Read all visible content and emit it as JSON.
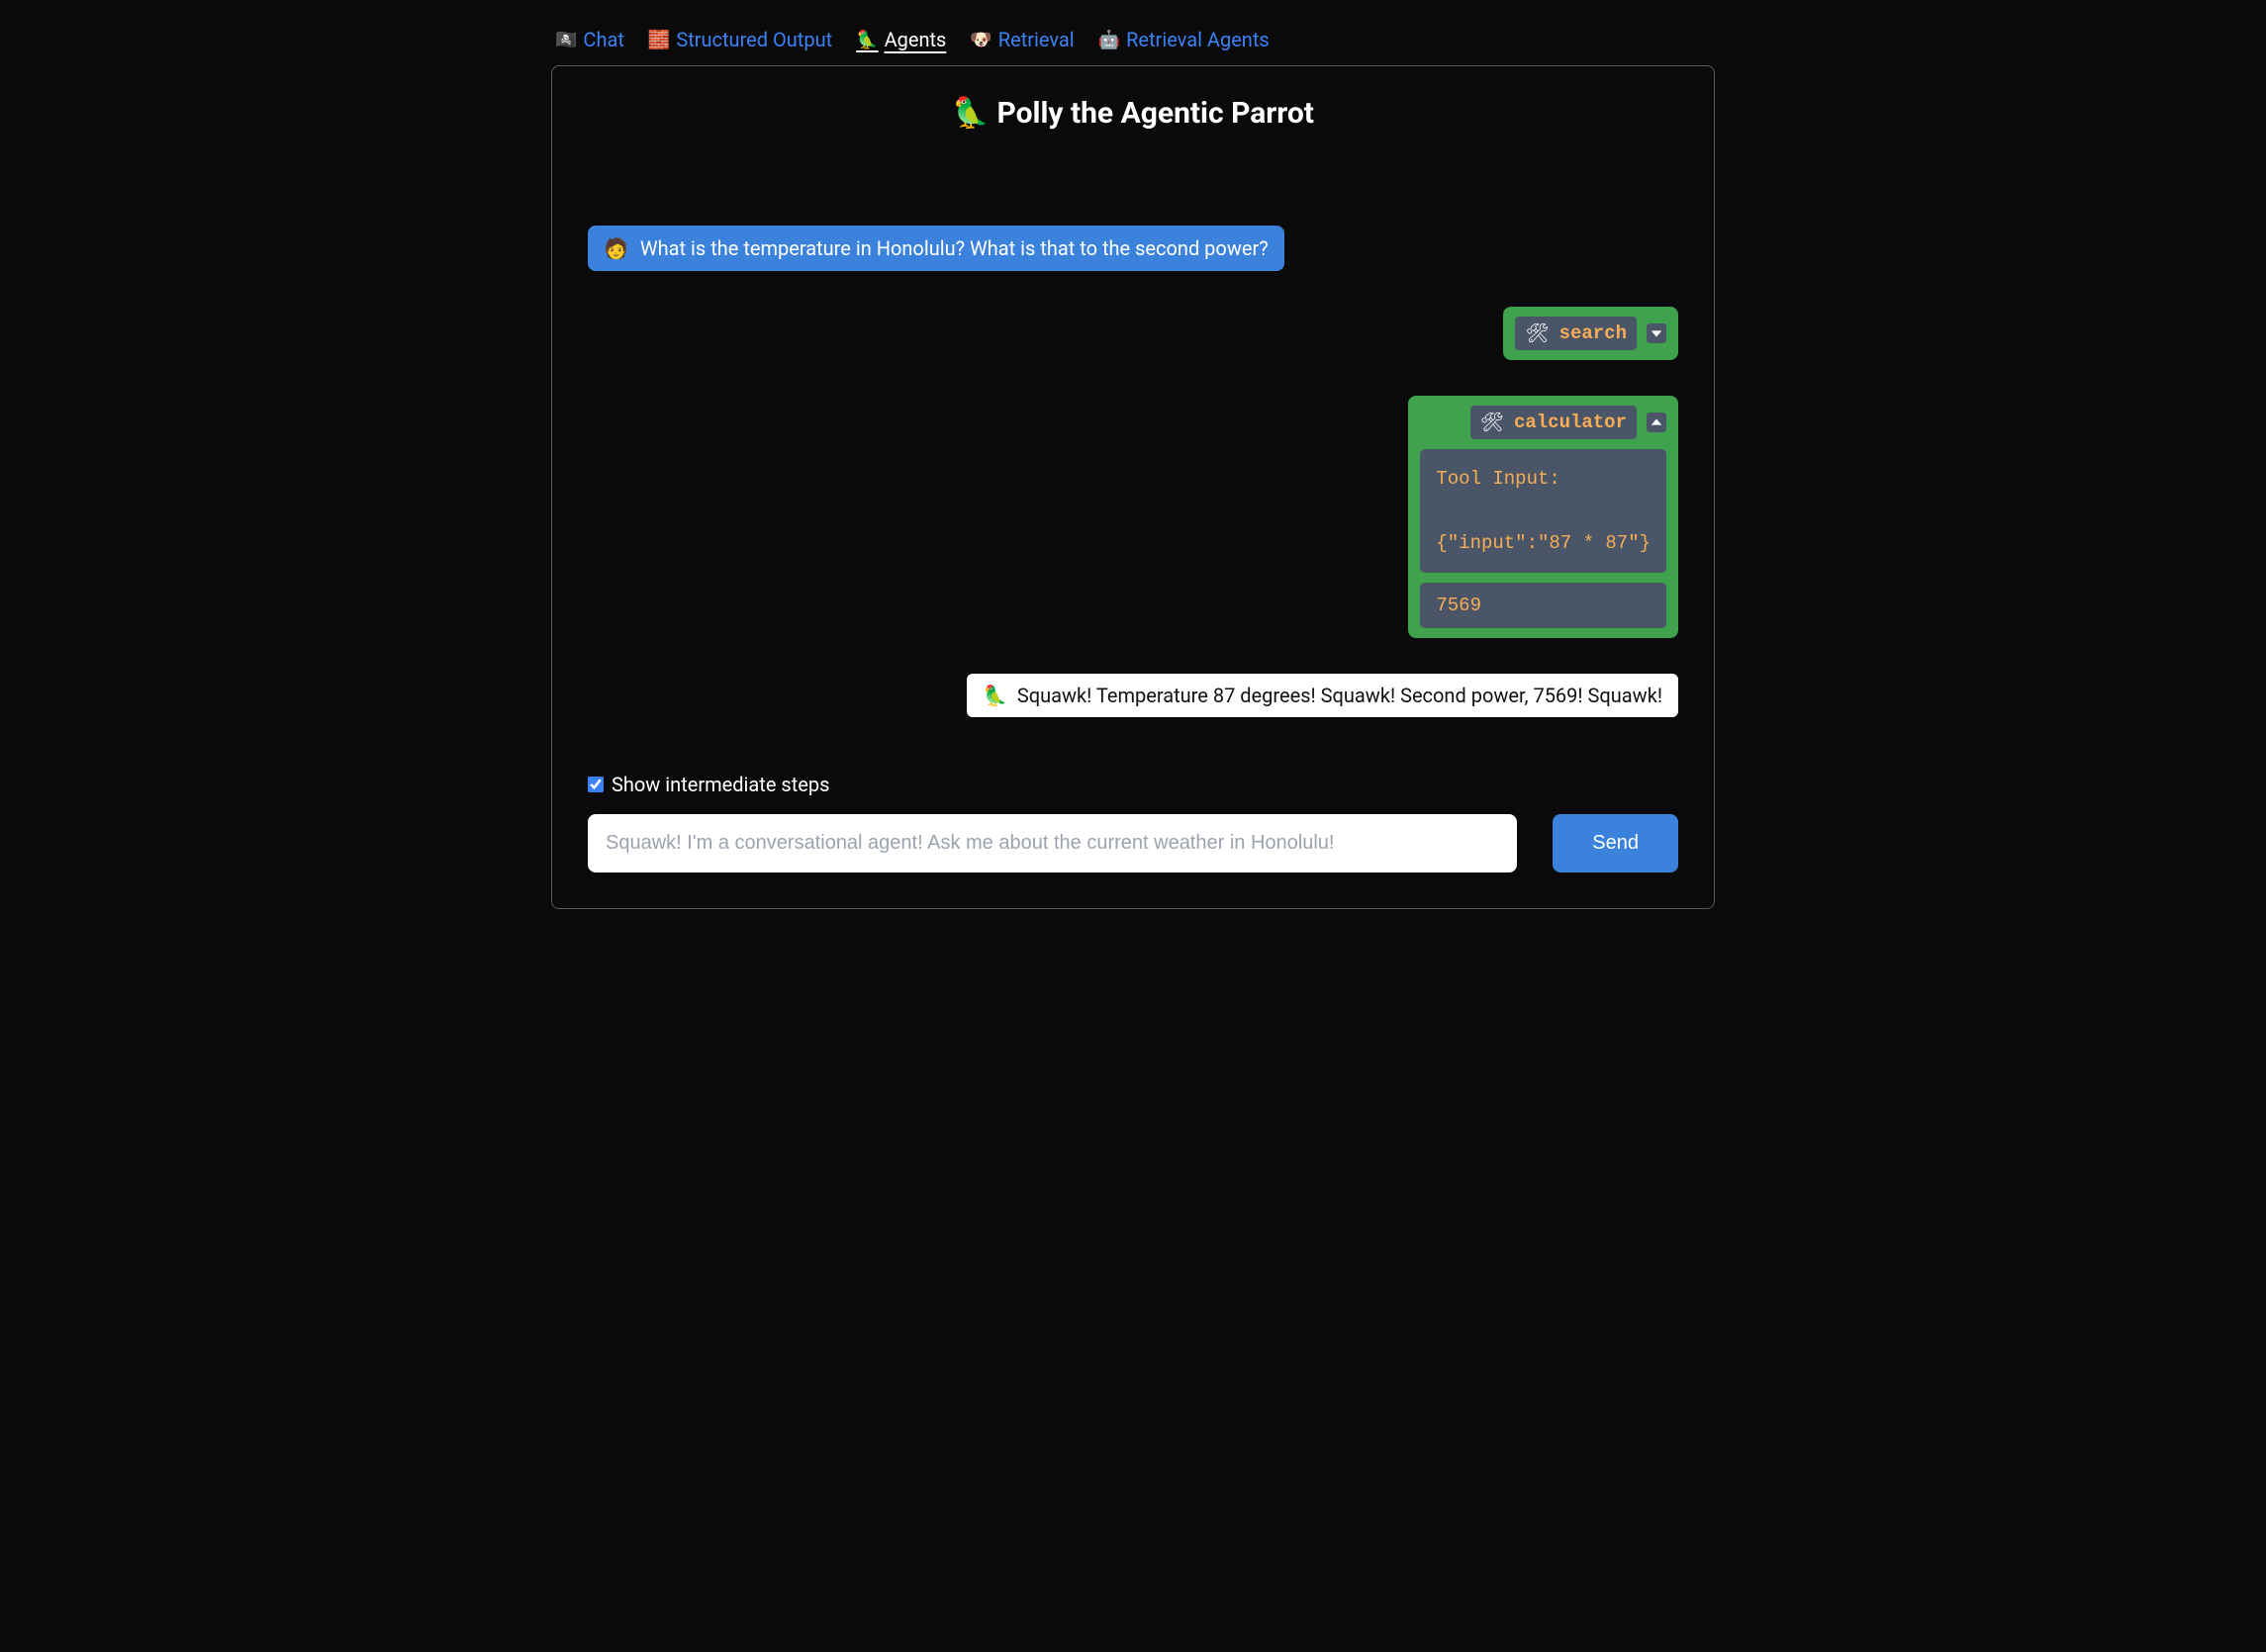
{
  "nav": {
    "items": [
      {
        "emoji": "🏴‍☠️",
        "label": "Chat",
        "active": false
      },
      {
        "emoji": "🧱",
        "label": "Structured Output",
        "active": false
      },
      {
        "emoji": "🦜",
        "label": "Agents",
        "active": true
      },
      {
        "emoji": "🐶",
        "label": "Retrieval",
        "active": false
      },
      {
        "emoji": "🤖",
        "label": "Retrieval Agents",
        "active": false
      }
    ]
  },
  "header": {
    "emoji": "🦜",
    "title": "Polly the Agentic Parrot"
  },
  "chat": {
    "user_emoji": "🧑",
    "user_message": "What is the temperature in Honolulu? What is that to the second power?",
    "tool_icon": "🛠",
    "tool_steps": [
      {
        "name": "search",
        "expanded": false
      },
      {
        "name": "calculator",
        "expanded": true,
        "input_label": "Tool Input:",
        "input_body": "{\"input\":\"87 * 87\"}",
        "output": "7569"
      }
    ],
    "assistant_emoji": "🦜",
    "assistant_message": "Squawk! Temperature 87 degrees! Squawk! Second power, 7569! Squawk!"
  },
  "controls": {
    "checkbox_label": "Show intermediate steps",
    "checkbox_checked": true,
    "input_placeholder": "Squawk! I'm a conversational agent! Ask me about the current weather in Honolulu!",
    "send_label": "Send"
  }
}
